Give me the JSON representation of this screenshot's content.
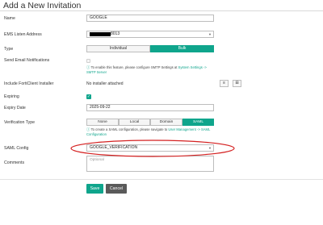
{
  "header": {
    "title": "Add a New Invitation"
  },
  "labels": {
    "name": "Name",
    "ems_listen_address": "EMS Listen Address",
    "type": "Type",
    "send_email": "Send Email Notifications",
    "include_installer": "Include FortiClient Installer",
    "expiring": "Expiring",
    "expiry_date": "Expiry Date",
    "verification_type": "Verification Type",
    "saml_config": "SAML Config",
    "comments": "Comments"
  },
  "fields": {
    "name_value": "GOOGLE",
    "ems_address_suffix": "8013",
    "expiry_date_value": "2025-09-22",
    "saml_config_value": "GOOGLE_VERIFICATION",
    "comments_placeholder": "Optional",
    "installer_value": "No installer attached"
  },
  "type_toggle": {
    "individual": "Individual",
    "bulk": "Bulk",
    "selected": "Bulk"
  },
  "notes": {
    "smtp_prefix": "To enable this feature, please configure SMTP Settings at ",
    "smtp_link": "System Settings -> SMTP Server",
    "saml_prefix": "To create a SAML configuration, please navigate to ",
    "saml_link": "User Management -> SAML Configuration"
  },
  "verification": {
    "options": [
      "None",
      "Local",
      "Domain",
      "SAML"
    ],
    "selected": "SAML"
  },
  "buttons": {
    "save": "Save",
    "cancel": "Cancel"
  },
  "colors": {
    "accent": "#0fa58c",
    "annotation": "#d42020",
    "cancel": "#5a5a5a"
  },
  "icons": {
    "installer_list": "list-icon",
    "installer_add": "plus-square-icon",
    "info": "info-circle-icon",
    "dropdown": "chevron-down-icon",
    "check": "checkmark-icon"
  }
}
